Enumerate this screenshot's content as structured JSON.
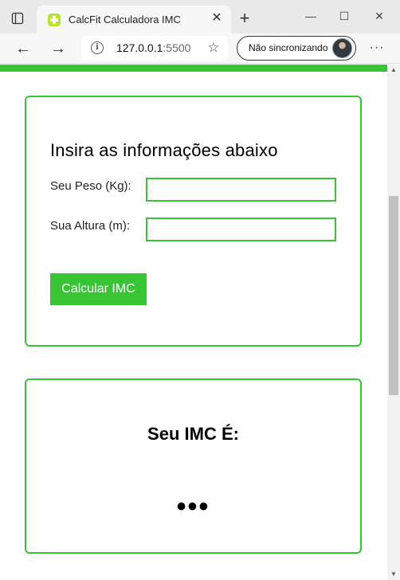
{
  "browser": {
    "tab_title": "CalcFit Calculadora IMC",
    "url_host": "127.0.0.1",
    "url_port": ":5500",
    "sync_label": "Não sincronizando",
    "icons": {
      "tab_actions": "tab-actions-icon",
      "favicon": "plus-cross-icon",
      "close": "close-icon",
      "new_tab": "plus-icon",
      "back": "arrow-left-icon",
      "forward": "arrow-right-icon",
      "info": "info-icon",
      "favorites": "star-add-icon",
      "more": "more-horizontal-icon"
    },
    "symbols": {
      "close": "✕",
      "new_tab": "+",
      "minimize": "—",
      "maximize": "☐",
      "win_close": "✕",
      "back": "←",
      "forward": "→",
      "info": "i",
      "favorites": "☆",
      "more": "···"
    }
  },
  "page": {
    "accent_color": "#37c534",
    "form": {
      "title": "Insira as informações abaixo",
      "weight_label": "Seu Peso (Kg):",
      "weight_value": "",
      "height_label": "Sua Altura (m):",
      "height_value": "",
      "submit_label": "Calcular IMC"
    },
    "result": {
      "title": "Seu IMC É:",
      "value": "•••"
    }
  }
}
